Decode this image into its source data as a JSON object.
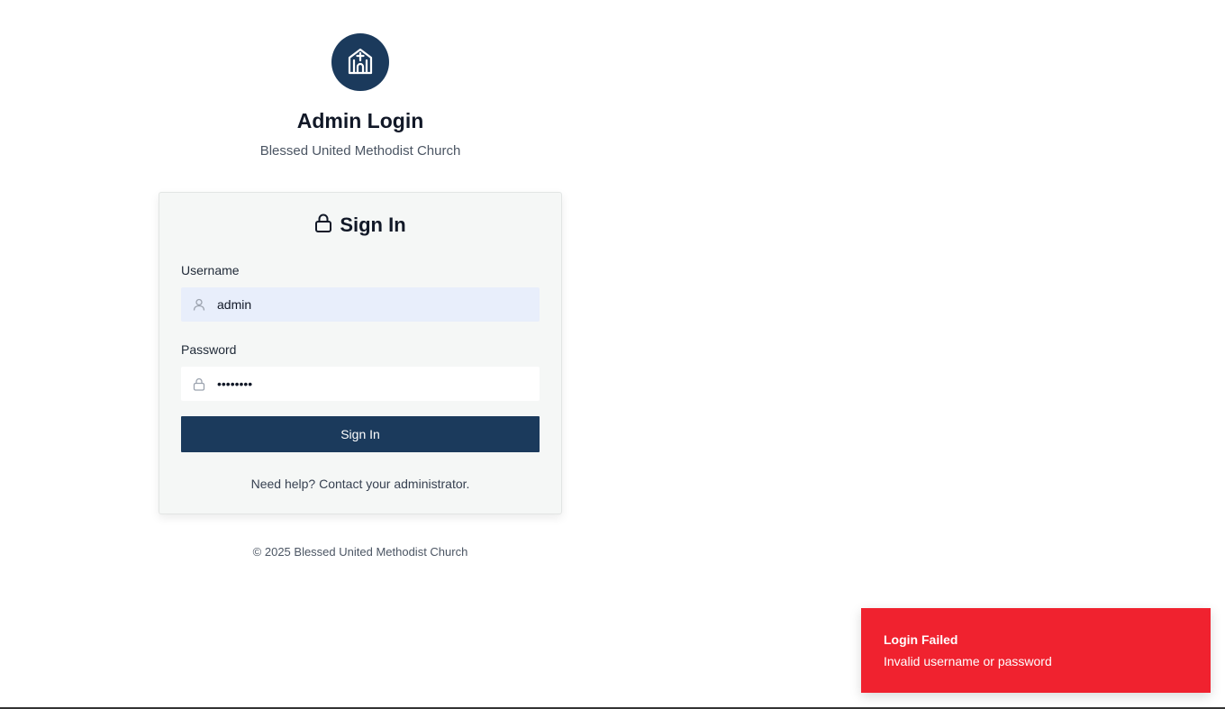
{
  "brand": {
    "title": "Admin Login",
    "subtitle": "Blessed United Methodist Church",
    "logo_icon": "church-icon",
    "accent_color": "#1b3a5c"
  },
  "card": {
    "title": "Sign In",
    "title_icon": "lock-icon",
    "username": {
      "label": "Username",
      "value": "admin",
      "icon": "user-icon"
    },
    "password": {
      "label": "Password",
      "value": "••••••••",
      "icon": "lock-icon"
    },
    "submit_label": "Sign In",
    "help_text": "Need help? Contact your administrator."
  },
  "footer": {
    "copyright": "© 2025 Blessed United Methodist Church"
  },
  "toast": {
    "title": "Login Failed",
    "message": "Invalid username or password",
    "color": "#f0222f"
  }
}
